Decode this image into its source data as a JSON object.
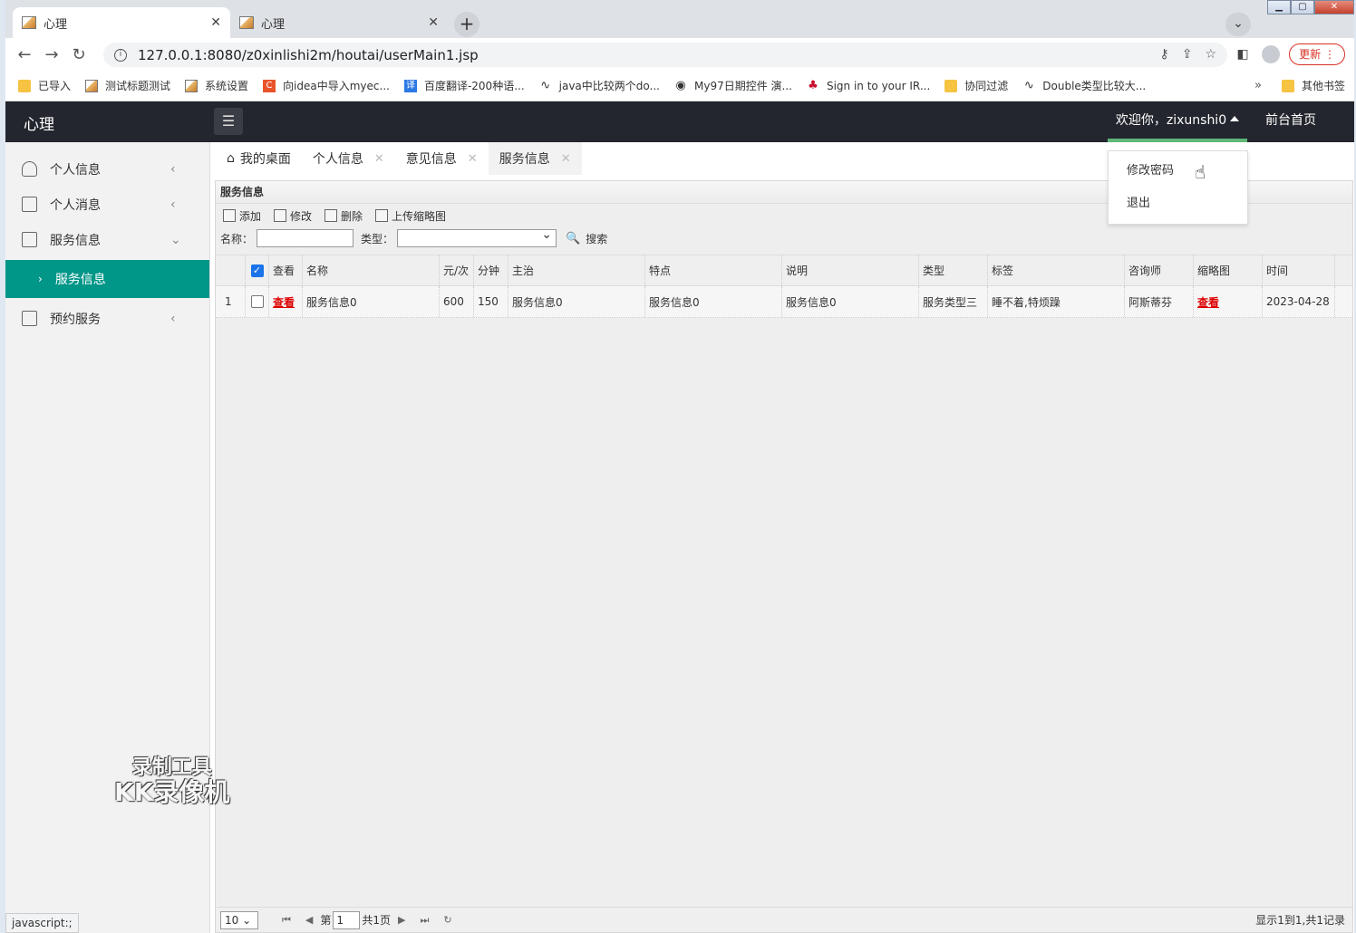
{
  "browser": {
    "tabs": [
      {
        "title": "心理",
        "close": "✕"
      },
      {
        "title": "心理",
        "close": "✕"
      }
    ],
    "new_tab": "+",
    "url": "127.0.0.1:8080/z0xinlishi2m/houtai/userMain1.jsp",
    "update_label": "更新",
    "bookmarks": [
      {
        "label": "已导入",
        "icon": "folder-icon"
      },
      {
        "label": "测试标题测试",
        "icon": "image-icon"
      },
      {
        "label": "系统设置",
        "icon": "image-icon"
      },
      {
        "label": "向idea中导入myec...",
        "icon": "c-red-icon"
      },
      {
        "label": "百度翻译-200种语...",
        "icon": "translate-icon"
      },
      {
        "label": "java中比较两个do...",
        "icon": "glyph-icon"
      },
      {
        "label": "My97日期控件 演...",
        "icon": "globe-icon"
      },
      {
        "label": "Sign in to your IR...",
        "icon": "maple-leaf-icon"
      },
      {
        "label": "协同过滤",
        "icon": "folder-icon"
      },
      {
        "label": "Double类型比较大...",
        "icon": "glyph-icon"
      }
    ],
    "bookmarks_more": "»",
    "other_bookmarks": "其他书签",
    "status_text": "javascript:;"
  },
  "app": {
    "logo": "心理",
    "welcome": "欢迎你，zixunshi0",
    "front_link": "前台首页",
    "dropdown": [
      "修改密码",
      "退出"
    ]
  },
  "sidebar": {
    "items": [
      {
        "label": "个人信息",
        "arrow": "‹"
      },
      {
        "label": "个人消息",
        "arrow": "‹"
      },
      {
        "label": "服务信息",
        "arrow": "⌄"
      },
      {
        "label": "预约服务",
        "arrow": "‹"
      }
    ],
    "sub_item": "服务信息"
  },
  "page_tabs": [
    {
      "label": "我的桌面"
    },
    {
      "label": "个人信息"
    },
    {
      "label": "意见信息"
    },
    {
      "label": "服务信息"
    }
  ],
  "panel": {
    "title": "服务信息",
    "toolbar": [
      "添加",
      "修改",
      "删除",
      "上传缩略图"
    ],
    "search": {
      "name_label": "名称：",
      "type_label": "类型：",
      "search_label": "搜索"
    },
    "columns": [
      "查看",
      "名称",
      "元/次",
      "分钟",
      "主治",
      "特点",
      "说明",
      "类型",
      "标签",
      "咨询师",
      "缩略图",
      "时间"
    ],
    "rows": [
      {
        "num": "1",
        "view": "查看",
        "name": "服务信息0",
        "price": "600",
        "minutes": "150",
        "main": "服务信息0",
        "feature": "服务信息0",
        "desc": "服务信息0",
        "type": "服务类型三",
        "tags": "睡不着,特烦躁",
        "counselor": "阿斯蒂芬",
        "thumb": "查看",
        "time": "2023-04-28"
      }
    ],
    "pager": {
      "page_size": "10",
      "page_prefix": "第",
      "page_value": "1",
      "page_total": "共1页",
      "info": "显示1到1,共1记录"
    }
  },
  "watermark": {
    "line1": "录制工具",
    "line2": "KK录像机"
  },
  "colors": {
    "accent": "#009688",
    "header": "#23262e",
    "underline": "#5fb878",
    "link": "#dd0000"
  }
}
